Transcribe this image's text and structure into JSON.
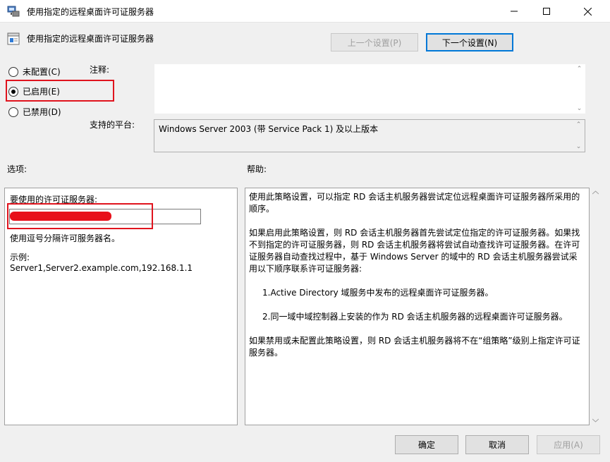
{
  "window": {
    "title": "使用指定的远程桌面许可证服务器"
  },
  "header": {
    "title": "使用指定的远程桌面许可证服务器",
    "prev_label": "上一个设置(P)",
    "next_label": "下一个设置(N)"
  },
  "state": {
    "not_configured": "未配置(C)",
    "enabled": "已启用(E)",
    "disabled": "已禁用(D)",
    "selected": "enabled"
  },
  "comment": {
    "label": "注释:",
    "value": ""
  },
  "platform": {
    "label": "支持的平台:",
    "value": "Windows Server 2003 (带 Service Pack 1) 及以上版本"
  },
  "options": {
    "heading": "选项:",
    "field_label": "要使用的许可证服务器:",
    "field_value": "",
    "hint": "使用逗号分隔许可服务器名。",
    "example_label": "示例:",
    "example_value": "Server1,Server2.example.com,192.168.1.1"
  },
  "help": {
    "heading": "帮助:",
    "paragraphs": [
      "使用此策略设置，可以指定 RD 会话主机服务器尝试定位远程桌面许可证服务器所采用的顺序。",
      "如果启用此策略设置，则 RD 会话主机服务器首先尝试定位指定的许可证服务器。如果找不到指定的许可证服务器，则 RD 会话主机服务器将尝试自动查找许可证服务器。在许可证服务器自动查找过程中，基于 Windows Server 的域中的 RD 会话主机服务器尝试采用以下顺序联系许可证服务器:",
      "1.Active Directory 域服务中发布的远程桌面许可证服务器。",
      "2.同一域中域控制器上安装的作为 RD 会话主机服务器的远程桌面许可证服务器。",
      "如果禁用或未配置此策略设置，则 RD 会话主机服务器将不在“组策略”级别上指定许可证服务器。"
    ]
  },
  "footer": {
    "ok_label": "确定",
    "cancel_label": "取消",
    "apply_label": "应用(A)"
  },
  "colors": {
    "highlight_red": "#e0141e",
    "focus_blue": "#0078d7"
  }
}
